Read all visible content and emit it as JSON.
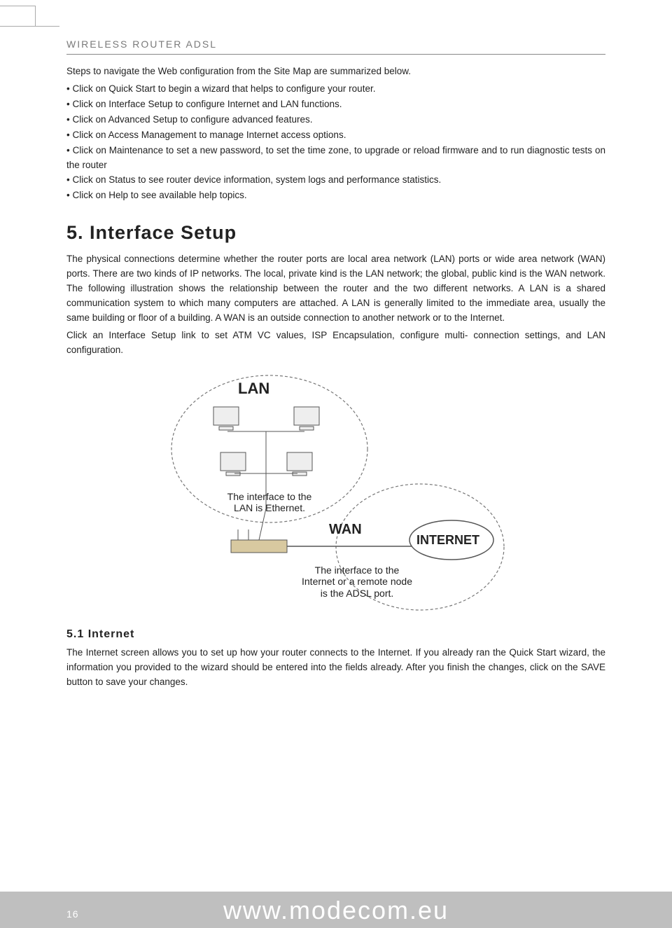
{
  "header": "WIRELESS ROUTER ADSL",
  "intro": "Steps to navigate the Web configuration from the Site Map are summarized below.",
  "bullets": [
    "Click on Quick Start to begin a wizard that helps to configure your router.",
    "Click on Interface Setup to configure Internet and LAN functions.",
    "Click on Advanced Setup to configure advanced features.",
    "Click on Access Management to manage Internet access options.",
    "Click on Maintenance to set a new password, to set the time zone, to upgrade or reload firmware and to run diagnostic tests on the router",
    "Click on Status to see router device information, system logs and performance statistics.",
    "Click on Help to see available help topics."
  ],
  "section5": {
    "title": "5. Interface Setup",
    "p1": "The physical connections determine whether the router ports are local area network (LAN) ports or wide area network (WAN) ports. There are two kinds of IP networks. The local, private kind is the LAN network; the global, public kind is the WAN network. The following illustration shows the relationship between the router and the two different networks. A LAN is a shared communication system to which many computers are attached. A LAN is generally limited to the immediate area, usually the same building or floor of a building. A WAN is an outside connection to another network or to the Internet.",
    "p2": "Click an Interface Setup link to set ATM VC values, ISP Encapsulation, configure multi- connection settings, and LAN configuration."
  },
  "diagram": {
    "lan": "LAN",
    "wan": "WAN",
    "internet": "INTERNET",
    "lan_caption": "The interface to the LAN is Ethernet.",
    "wan_caption": "The interface to the Internet or a remote node is the ADSL port."
  },
  "section51": {
    "title": "5.1 Internet",
    "p": "The Internet screen allows you to set up how your router connects to the Internet. If you already ran the Quick Start wizard, the information you provided to the wizard should be entered into the fields already. After you finish the changes, click on the SAVE button to save your changes."
  },
  "footer": {
    "page": "16",
    "url": "www.modecom.eu"
  }
}
